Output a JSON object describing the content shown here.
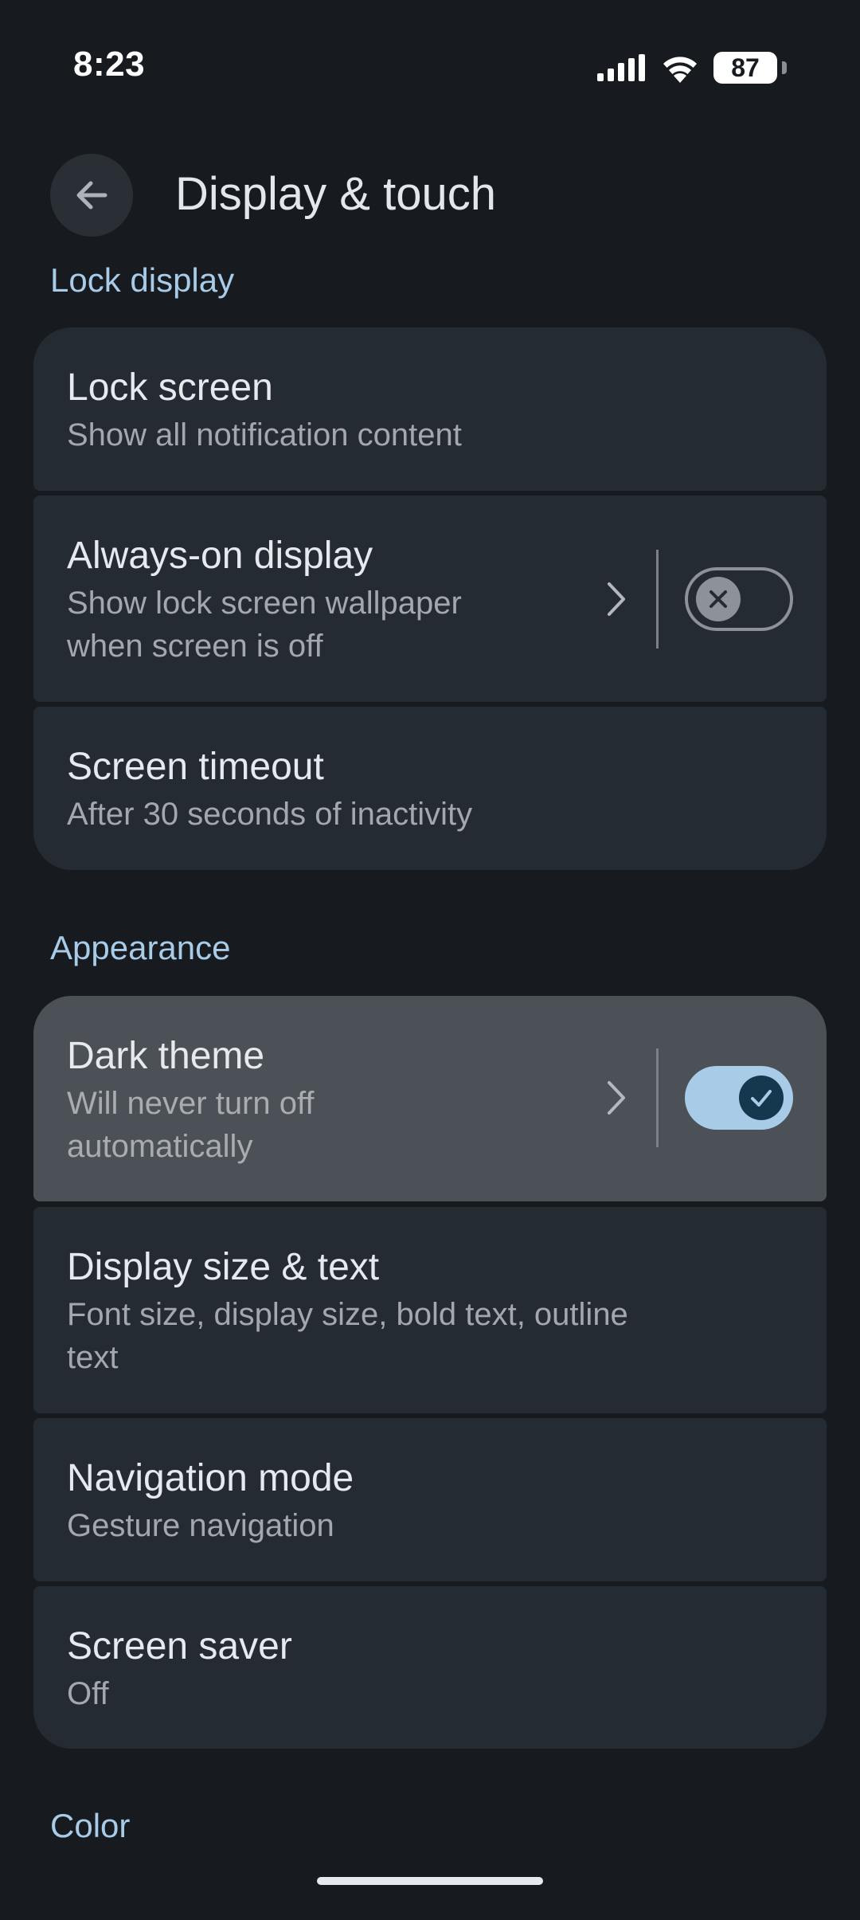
{
  "status_bar": {
    "time": "8:23",
    "battery_level": "87",
    "signal_icon": "cellular-signal-icon",
    "wifi_icon": "wifi-icon"
  },
  "app_bar": {
    "back_icon": "arrow-back-icon",
    "title": "Display & touch"
  },
  "sections": {
    "lock_display": {
      "header": "Lock display",
      "items": {
        "lock_screen": {
          "title": "Lock screen",
          "summary": "Show all notification content"
        },
        "always_on": {
          "title": "Always-on display",
          "summary_line1": "Show lock screen wallpaper",
          "summary_line2": "when screen is off",
          "toggle": "off"
        },
        "screen_timeout": {
          "title": "Screen timeout",
          "summary": "After 30 seconds of inactivity"
        }
      }
    },
    "appearance": {
      "header": "Appearance",
      "items": {
        "dark_theme": {
          "title": "Dark theme",
          "summary_line1": "Will never turn off",
          "summary_line2": "automatically",
          "toggle": "on"
        },
        "display_size": {
          "title": "Display size & text",
          "summary_line1": "Font size, display size, bold text, outline",
          "summary_line2": "text"
        },
        "navigation_mode": {
          "title": "Navigation mode",
          "summary": "Gesture navigation"
        },
        "screen_saver": {
          "title": "Screen saver",
          "summary": "Off"
        }
      }
    },
    "color": {
      "header": "Color"
    }
  },
  "colors": {
    "background": "#171b20",
    "card": "#252b33",
    "card_highlight": "#4c5157",
    "accent": "#a8cbe8",
    "switch_on_thumb": "#16384f"
  }
}
